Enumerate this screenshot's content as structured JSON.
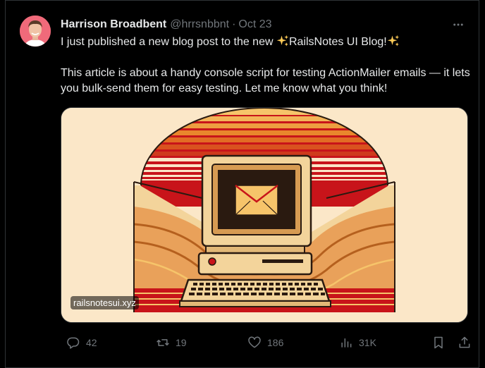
{
  "author": {
    "display_name": "Harrison Broadbent",
    "handle": "@hrrsnbbnt",
    "separator": "·",
    "timestamp": "Oct 23"
  },
  "tweet": {
    "line1_before": "I just published a new blog post to the new ",
    "line1_link": "RailsNotes UI Blog!",
    "paragraph2": "This article is about a handy console script for testing ActionMailer emails — it lets you bulk-send them for easy testing. Let me know what you think!"
  },
  "media": {
    "domain_badge": "railsnotesui.xyz",
    "colors": {
      "background": "#fbe7c8",
      "red": "#c8141a",
      "orange": "#e9862c",
      "yellow": "#f6c46a",
      "tan": "#f3d49b"
    }
  },
  "actions": {
    "replies": "42",
    "reposts": "19",
    "likes": "186",
    "views": "31K"
  },
  "icons": {
    "more": "more-horizontal-icon",
    "reply": "reply-icon",
    "repost": "repost-icon",
    "like": "heart-icon",
    "views": "views-icon",
    "bookmark": "bookmark-icon",
    "share": "share-icon",
    "sparkle": "sparkles-icon"
  },
  "theme": {
    "text": "#e7e9ea",
    "muted": "#71767b",
    "border": "#2f3336",
    "background": "#000000"
  }
}
